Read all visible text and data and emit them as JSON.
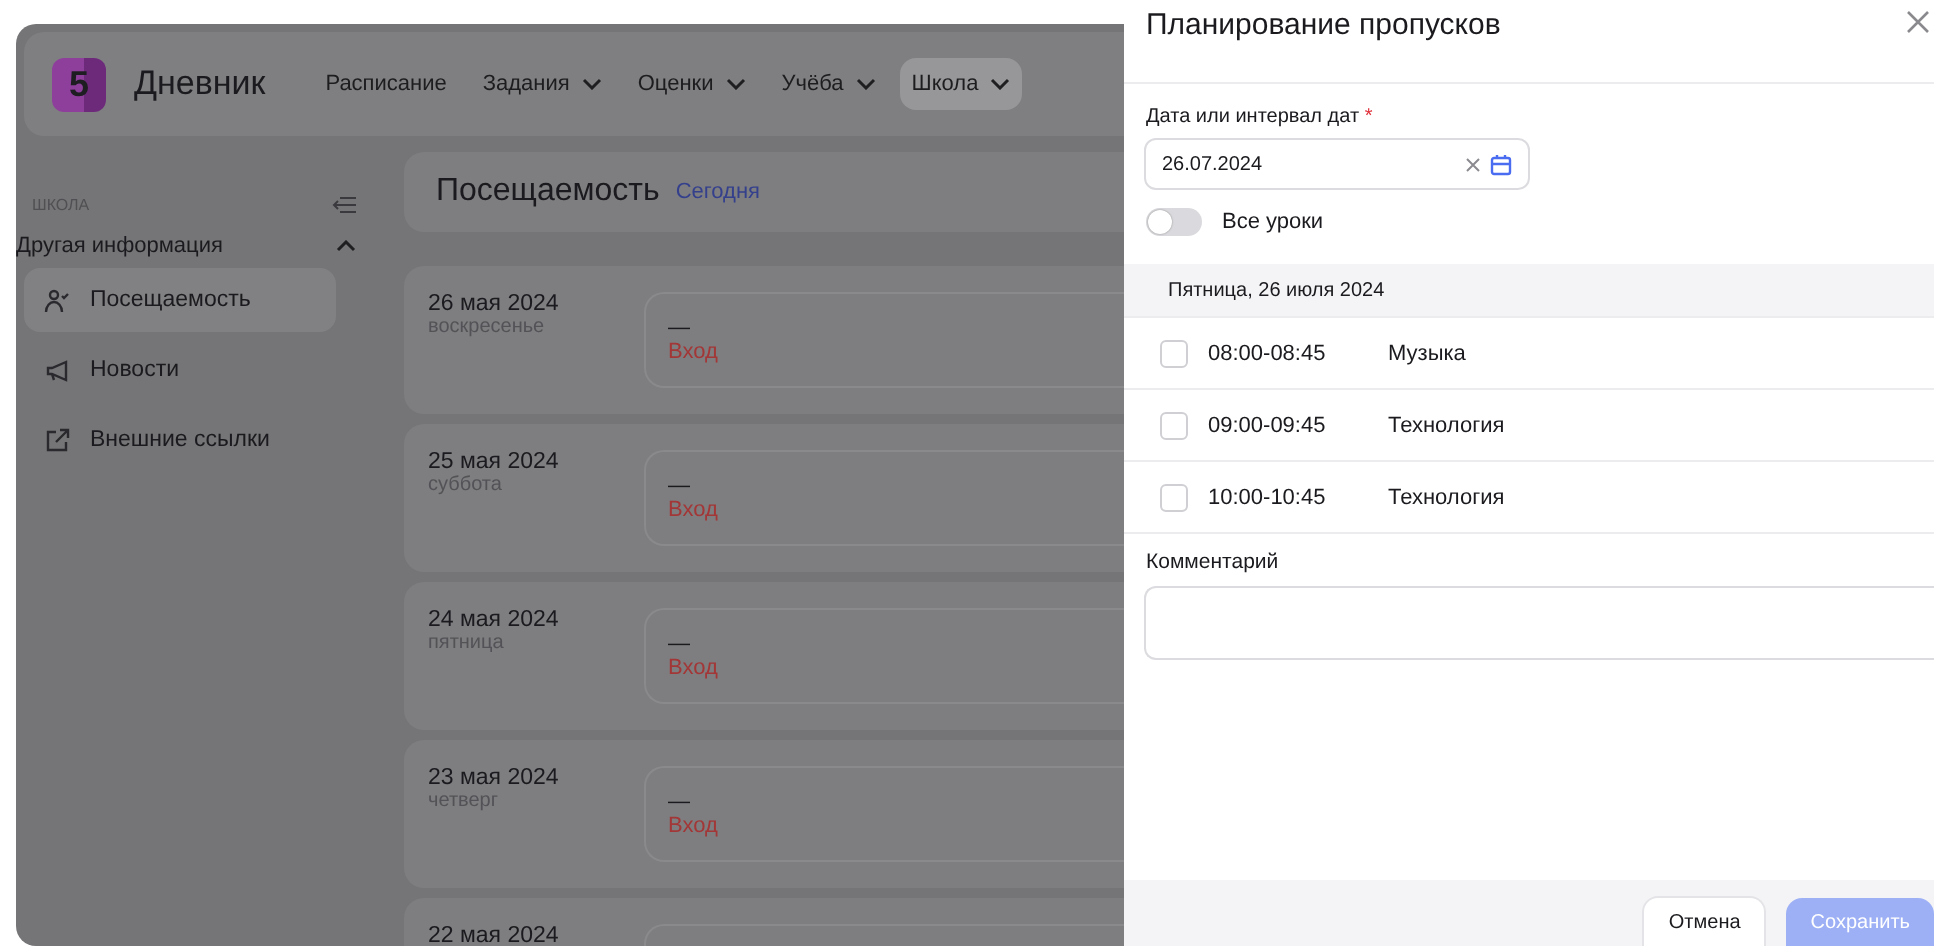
{
  "header": {
    "logo": "5",
    "brand": "Дневник",
    "nav": [
      {
        "label": "Расписание",
        "has_menu": false,
        "selected": false
      },
      {
        "label": "Задания",
        "has_menu": true,
        "selected": false
      },
      {
        "label": "Оценки",
        "has_menu": true,
        "selected": false
      },
      {
        "label": "Учёба",
        "has_menu": true,
        "selected": false
      },
      {
        "label": "Школа",
        "has_menu": true,
        "selected": true
      }
    ]
  },
  "sidebar": {
    "heading": "ШКОЛА",
    "group": {
      "label": "Другая информация",
      "expanded": true
    },
    "items": [
      {
        "label": "Посещаемость",
        "kind": "attendance",
        "selected": true
      },
      {
        "label": "Новости",
        "kind": "news",
        "selected": false
      },
      {
        "label": "Внешние ссылки",
        "kind": "links",
        "selected": false
      }
    ]
  },
  "page": {
    "title": "Посещаемость",
    "today_link": "Сегодня"
  },
  "days": [
    {
      "date": "26 мая 2024",
      "weekday": "воскресенье",
      "mark": "—",
      "entry": "Вход"
    },
    {
      "date": "25 мая 2024",
      "weekday": "суббота",
      "mark": "—",
      "entry": "Вход"
    },
    {
      "date": "24 мая 2024",
      "weekday": "пятница",
      "mark": "—",
      "entry": "Вход"
    },
    {
      "date": "23 мая 2024",
      "weekday": "четверг",
      "mark": "—",
      "entry": "Вход"
    },
    {
      "date": "22 мая 2024"
    }
  ],
  "dialog": {
    "title": "Планирование пропусков",
    "date_field": {
      "label": "Дата или интервал дат",
      "required_mark": "*",
      "value": "26.07.2024"
    },
    "toggle": {
      "label": "Все уроки",
      "on": false
    },
    "day_header": "Пятница, 26 июля 2024",
    "lessons": [
      {
        "time": "08:00-08:45",
        "subject": "Музыка",
        "checked": false
      },
      {
        "time": "09:00-09:45",
        "subject": "Технология",
        "checked": false
      },
      {
        "time": "10:00-10:45",
        "subject": "Технология",
        "checked": false
      }
    ],
    "comment": {
      "label": "Комментарий"
    },
    "buttons": [
      {
        "label": "Отмена",
        "kind": "secondary",
        "disabled": false
      },
      {
        "label": "Сохранить",
        "kind": "primary",
        "disabled": true
      }
    ]
  }
}
